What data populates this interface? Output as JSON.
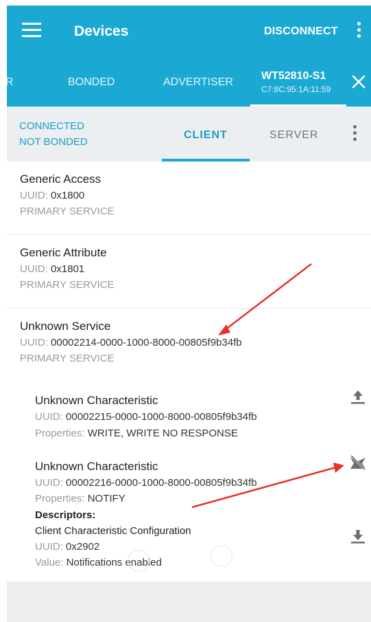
{
  "appbar": {
    "title": "Devices",
    "disconnect_label": "DISCONNECT"
  },
  "tabs": {
    "partial_left": "R",
    "bonded": "BONDED",
    "advertiser": "ADVERTISER",
    "active_device_name": "WT52810-S1",
    "active_device_mac": "C7:8C:95:1A:11:59"
  },
  "connection": {
    "state": "CONNECTED",
    "bond": "NOT BONDED"
  },
  "subtabs": {
    "client": "CLIENT",
    "server": "SERVER"
  },
  "labels": {
    "uuid": "UUID:",
    "properties": "Properties:",
    "descriptors": "Descriptors:",
    "value": "Value:"
  },
  "services": [
    {
      "name": "Generic Access",
      "uuid": "0x1800",
      "type": "PRIMARY SERVICE"
    },
    {
      "name": "Generic Attribute",
      "uuid": "0x1801",
      "type": "PRIMARY SERVICE"
    },
    {
      "name": "Unknown Service",
      "uuid": "00002214-0000-1000-8000-00805f9b34fb",
      "type": "PRIMARY SERVICE"
    }
  ],
  "characteristics": [
    {
      "name": "Unknown Characteristic",
      "uuid": "00002215-0000-1000-8000-00805f9b34fb",
      "properties": "WRITE, WRITE NO RESPONSE",
      "action_icon": "upload-icon"
    },
    {
      "name": "Unknown Characteristic",
      "uuid": "00002216-0000-1000-8000-00805f9b34fb",
      "properties": "NOTIFY",
      "action_icon": "notifications-disable-icon"
    }
  ],
  "descriptor": {
    "name": "Client Characteristic Configuration",
    "uuid": "0x2902",
    "value": "Notifications enabled",
    "action_icon": "download-icon"
  },
  "colors": {
    "primary": "#1ba9d3",
    "accent_text": "#1a9dc8",
    "subbar": "#eceff1",
    "annotation_arrow": "#e8312a"
  }
}
